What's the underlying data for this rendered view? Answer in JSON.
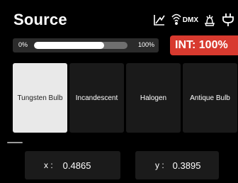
{
  "header": {
    "title": "Source",
    "dmx_label": "DMX",
    "icons": [
      "chart-icon",
      "dmx-icon",
      "fan-icon",
      "plug-icon"
    ]
  },
  "intensity": {
    "min_label": "0%",
    "max_label": "100%",
    "fill_fraction": 0.75,
    "value_label": "INT: 100%"
  },
  "presets": [
    {
      "label": "Tungsten Bulb",
      "selected": true
    },
    {
      "label": "Incandescent",
      "selected": false
    },
    {
      "label": "Halogen",
      "selected": false
    },
    {
      "label": "Antique Bulb",
      "selected": false
    }
  ],
  "coordinates": {
    "x_label": "x :",
    "x_value": "0.4865",
    "y_label": "y :",
    "y_value": "0.3895"
  },
  "colors": {
    "accent": "#d83a2f",
    "selected_tile": "#e9e9e9",
    "tile": "#1a1a1a"
  }
}
